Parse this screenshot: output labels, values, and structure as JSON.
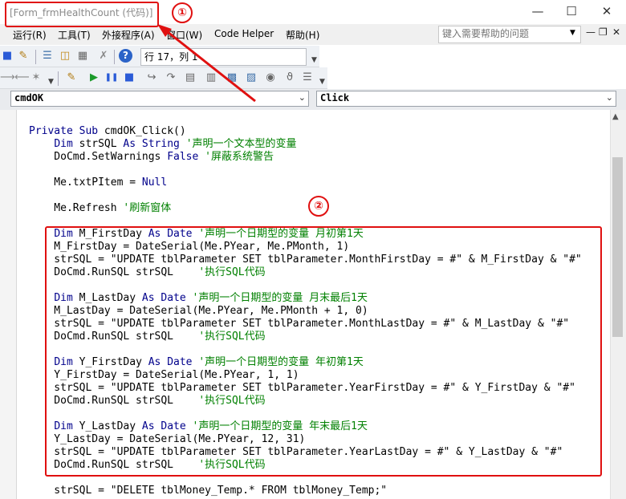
{
  "window": {
    "title": "[Form_frmHealthCount (代码)]"
  },
  "menu": [
    {
      "label": "运行(R)"
    },
    {
      "label": "工具(T)"
    },
    {
      "label": "外接程序(A)"
    },
    {
      "label": "窗口(W)"
    },
    {
      "label": "Code Helper"
    },
    {
      "label": "帮助(H)"
    }
  ],
  "help": {
    "placeholder": "键入需要帮助的问题"
  },
  "status": {
    "position": "行 17，列 1"
  },
  "combos": {
    "object": "cmdOK",
    "procedure": "Click"
  },
  "annotations": {
    "badge1": "①",
    "badge2": "②"
  },
  "code": [
    {
      "t": "Private Sub cmdOK_Click()",
      "k": "",
      "c": ""
    },
    {
      "t": "    Dim strSQL As String ",
      "k": "",
      "c": "'声明一个文本型的变量"
    },
    {
      "t": "    DoCmd.SetWarnings False ",
      "k": "",
      "c": "'屏蔽系统警告"
    },
    {
      "t": "",
      "k": "",
      "c": ""
    },
    {
      "t": "    Me.txtPItem = Null",
      "k": "",
      "c": ""
    },
    {
      "t": "",
      "k": "",
      "c": ""
    },
    {
      "t": "    Me.Refresh ",
      "k": "",
      "c": "'刷新窗体"
    },
    {
      "t": "",
      "k": "",
      "c": ""
    },
    {
      "t": "    Dim M_FirstDay As Date ",
      "k": "",
      "c": "'声明一个日期型的变量 月初第1天"
    },
    {
      "t": "    M_FirstDay = DateSerial(Me.PYear, Me.PMonth, 1)",
      "k": "",
      "c": ""
    },
    {
      "t": "    strSQL = \"UPDATE tblParameter SET tblParameter.MonthFirstDay = #\" & M_FirstDay & \"#\"",
      "k": "",
      "c": ""
    },
    {
      "t": "    DoCmd.RunSQL strSQL    ",
      "k": "",
      "c": "'执行SQL代码"
    },
    {
      "t": "",
      "k": "",
      "c": ""
    },
    {
      "t": "    Dim M_LastDay As Date ",
      "k": "",
      "c": "'声明一个日期型的变量 月末最后1天"
    },
    {
      "t": "    M_LastDay = DateSerial(Me.PYear, Me.PMonth + 1, 0)",
      "k": "",
      "c": ""
    },
    {
      "t": "    strSQL = \"UPDATE tblParameter SET tblParameter.MonthLastDay = #\" & M_LastDay & \"#\"",
      "k": "",
      "c": ""
    },
    {
      "t": "    DoCmd.RunSQL strSQL    ",
      "k": "",
      "c": "'执行SQL代码"
    },
    {
      "t": "",
      "k": "",
      "c": ""
    },
    {
      "t": "    Dim Y_FirstDay As Date ",
      "k": "",
      "c": "'声明一个日期型的变量 年初第1天"
    },
    {
      "t": "    Y_FirstDay = DateSerial(Me.PYear, 1, 1)",
      "k": "",
      "c": ""
    },
    {
      "t": "    strSQL = \"UPDATE tblParameter SET tblParameter.YearFirstDay = #\" & Y_FirstDay & \"#\"",
      "k": "",
      "c": ""
    },
    {
      "t": "    DoCmd.RunSQL strSQL    ",
      "k": "",
      "c": "'执行SQL代码"
    },
    {
      "t": "",
      "k": "",
      "c": ""
    },
    {
      "t": "    Dim Y_LastDay As Date ",
      "k": "",
      "c": "'声明一个日期型的变量 年末最后1天"
    },
    {
      "t": "    Y_LastDay = DateSerial(Me.PYear, 12, 31)",
      "k": "",
      "c": ""
    },
    {
      "t": "    strSQL = \"UPDATE tblParameter SET tblParameter.YearLastDay = #\" & Y_LastDay & \"#\"",
      "k": "",
      "c": ""
    },
    {
      "t": "    DoCmd.RunSQL strSQL    ",
      "k": "",
      "c": "'执行SQL代码"
    },
    {
      "t": "",
      "k": "",
      "c": ""
    },
    {
      "t": "    strSQL = \"DELETE tblMoney_Temp.* FROM tblMoney_Temp;\"",
      "k": "",
      "c": ""
    }
  ]
}
